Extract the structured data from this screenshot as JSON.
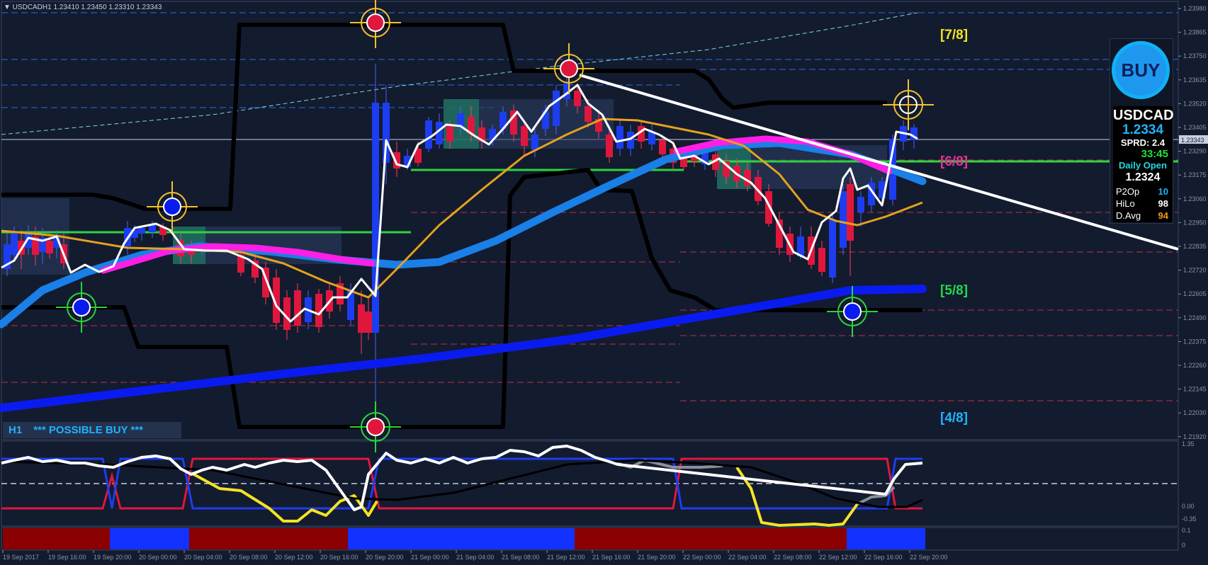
{
  "window": {
    "title": "▼ USDCADH1  1.23410 1.23450 1.23310 1.23343"
  },
  "price_axis": {
    "ticks": [
      "1.23980",
      "1.23865",
      "1.23750",
      "1.23635",
      "1.23520",
      "1.23405",
      "1.23290",
      "1.23175",
      "1.23060",
      "1.22950",
      "1.22835",
      "1.22720",
      "1.22605",
      "1.22490",
      "1.22375",
      "1.22260",
      "1.22145",
      "1.22030",
      "1.21920"
    ],
    "current_price_tag": "1.23343"
  },
  "time_axis": {
    "labels": [
      "19 Sep 2017",
      "19 Sep 16:00",
      "19 Sep 20:00",
      "20 Sep 00:00",
      "20 Sep 04:00",
      "20 Sep 08:00",
      "20 Sep 12:00",
      "20 Sep 16:00",
      "20 Sep 20:00",
      "21 Sep 00:00",
      "21 Sep 04:00",
      "21 Sep 08:00",
      "21 Sep 12:00",
      "21 Sep 16:00",
      "21 Sep 20:00",
      "22 Sep 00:00",
      "22 Sep 04:00",
      "22 Sep 08:00",
      "22 Sep 12:00",
      "22 Sep 16:00",
      "22 Sep 20:00"
    ]
  },
  "murrey_levels": [
    {
      "label": "[7/8]",
      "color": "#f4e325"
    },
    {
      "label": "[6/8]",
      "color": "#e7319a"
    },
    {
      "label": "[5/8]",
      "color": "#23d94a"
    },
    {
      "label": "[4/8]",
      "color": "#1fb3ff"
    }
  ],
  "signal": {
    "timeframe": "H1",
    "text": "*** POSSIBLE BUY ***"
  },
  "oscillator_axis": {
    "ticks": [
      "1.35",
      "0.00",
      "-0.35"
    ]
  },
  "histogram_axis": {
    "ticks": [
      "0.1",
      "0"
    ]
  },
  "panel": {
    "buy_button": "BUY",
    "symbol": "USDCAD",
    "price": "1.2334",
    "spread": "SPRD: 2.4",
    "timer": "33:45",
    "daily_open_label": "Daily Open",
    "daily_open_value": "1.2324",
    "stats": [
      {
        "key": "P2Op",
        "value": "10",
        "color": "#1fb3ff"
      },
      {
        "key": "HiLo",
        "value": "98",
        "color": "#ffffff"
      },
      {
        "key": "D.Avg",
        "value": "94",
        "color": "#f29a1a"
      }
    ]
  },
  "colors": {
    "background": "#131b2f",
    "bull_candle": "#1d3df0",
    "bear_candle": "#e0173d",
    "envelope": "#000000",
    "ma_fast": "#ffffff",
    "ma_mid": "#e4a21e",
    "ma_slow": "#1a7fe6",
    "ma_long": "#0a1bf0",
    "trend_highlight": "#ff1ee6",
    "trendline": "#ffffff",
    "support_line": "#2cd43c"
  }
}
